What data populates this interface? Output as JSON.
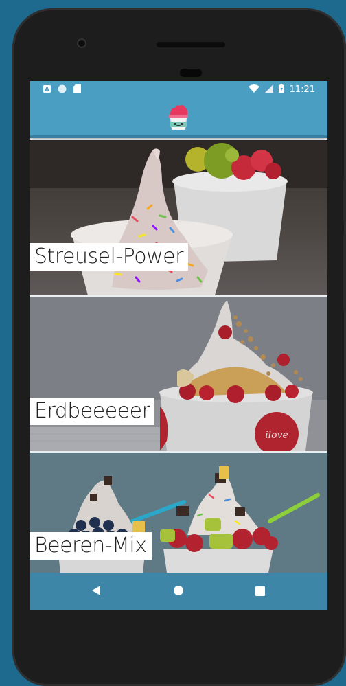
{
  "status_bar": {
    "time": "11:21",
    "left_icons": [
      "a-icon",
      "circle-icon",
      "sdcard-icon"
    ],
    "right_icons": [
      "wifi-icon",
      "signal-icon",
      "battery-icon"
    ]
  },
  "app_bar": {
    "logo_icon": "frozen-yogurt-logo-icon"
  },
  "items": [
    {
      "label": "Streusel-Power"
    },
    {
      "label": "Erdbeeeeer"
    },
    {
      "label": "Beeren-Mix"
    }
  ],
  "nav_bar": {
    "buttons": [
      "back-icon",
      "home-icon",
      "recents-icon"
    ]
  },
  "colors": {
    "background": "#1e6a8f",
    "app_bar": "#4a9ec2",
    "nav_bar": "#3e86a8"
  }
}
